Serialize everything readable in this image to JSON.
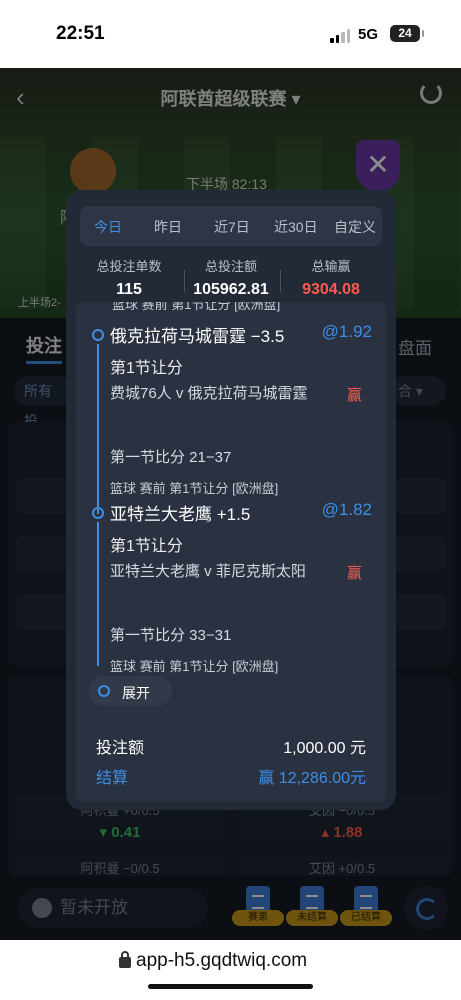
{
  "status_bar": {
    "time": "22:51",
    "network": "5G",
    "battery": "24"
  },
  "header": {
    "title": "阿联酋超级联赛 ▾",
    "period": "下半场",
    "match_clock": "82:13",
    "first_half_label": "上半场2-"
  },
  "tabs_below": {
    "bet_tab": "投注",
    "pan_tab": "盘面",
    "all_chip": "所有投",
    "combo_chip": "合"
  },
  "odds": [
    {
      "name": "阿积曼 +0/0.5",
      "value": "0.41",
      "direction": "down"
    },
    {
      "name": "艾因 −0/0.5",
      "value": "1.88",
      "direction": "up"
    },
    {
      "name": "阿积曼 −0/0.5",
      "value": "",
      "direction": ""
    },
    {
      "name": "艾因 +0/0.5",
      "value": "",
      "direction": ""
    }
  ],
  "bottom_bar": {
    "closed_label": "暂未开放",
    "buttons": [
      "赛果",
      "未结算",
      "已结算"
    ]
  },
  "modal": {
    "tabs": [
      {
        "label": "今日",
        "active": true
      },
      {
        "label": "昨日",
        "active": false
      },
      {
        "label": "近7日",
        "active": false
      },
      {
        "label": "近30日",
        "active": false
      },
      {
        "label": "自定义",
        "active": false
      }
    ],
    "stats": [
      {
        "label": "总投注单数",
        "value": "115"
      },
      {
        "label": "总投注额",
        "value": "105962.81"
      },
      {
        "label": "总输赢",
        "value": "9304.08"
      }
    ],
    "cutoff_text": "篮球 赛前 第1节让分 [欧洲盘]",
    "bets": [
      {
        "team": "俄克拉荷马城雷霆 −3.5",
        "odds": "@1.92",
        "market": "第1节让分",
        "match": "费城76人 v 俄克拉荷马城雷霆",
        "result": "赢",
        "score": "第一节比分 21−37",
        "tag": "篮球 赛前  第1节让分 [欧洲盘]"
      },
      {
        "team": "亚特兰大老鹰 +1.5",
        "odds": "@1.82",
        "market": "第1节让分",
        "match": "亚特兰大老鹰 v 菲尼克斯太阳",
        "result": "赢",
        "score": "第一节比分 33−31",
        "tag": "篮球 赛前  第1节让分 [欧洲盘]"
      }
    ],
    "expand_label": "展开",
    "stake_label": "投注额",
    "stake_value": "1,000.00 元",
    "settle_label": "结算",
    "settle_value": "赢 12,286.00元"
  },
  "url_bar": {
    "url": "app-h5.gqdtwiq.com"
  },
  "colors": {
    "accent": "#3d8fe6",
    "win": "#ff5a4e",
    "modal_bg": "#232a37",
    "odds_down": "#3fc26b",
    "odds_up": "#ff5a4e"
  }
}
